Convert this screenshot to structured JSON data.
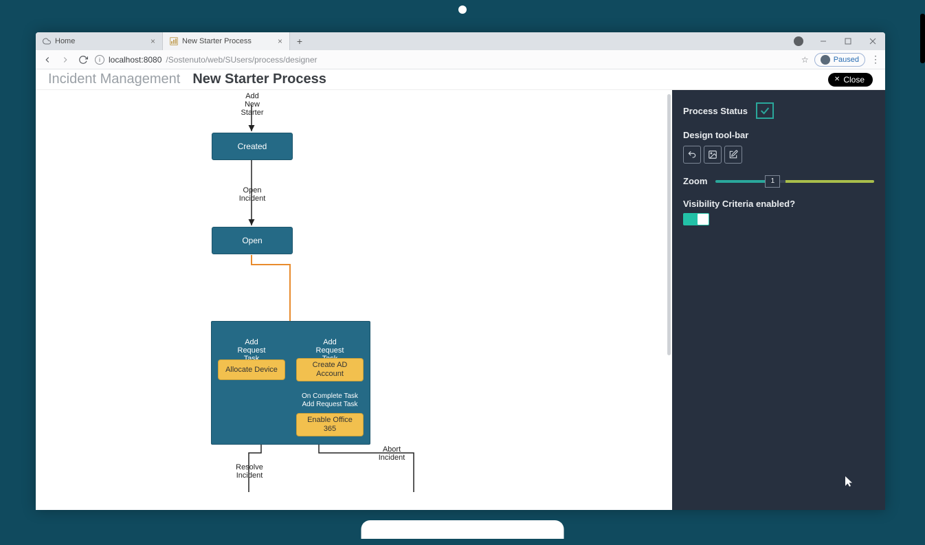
{
  "browser": {
    "tabs": [
      {
        "label": "Home"
      },
      {
        "label": "New Starter Process"
      }
    ],
    "url_host": "localhost:8080",
    "url_path": "/Sostenuto/web/SUsers/process/designer",
    "paused_label": "Paused"
  },
  "page": {
    "breadcrumb": "Incident Management",
    "title": "New Starter Process",
    "close_label": "Close"
  },
  "flow": {
    "labels": {
      "add_new_starter": "Add\nNew Starter",
      "open_incident": "Open\nIncident",
      "add_request_task_left": "Add\nRequest Task",
      "add_request_task_right": "Add\nRequest Task",
      "on_complete": "On Complete Task\nAdd Request Task",
      "abort_incident": "Abort\nIncident",
      "resolve_incident": "Resolve\nIncident"
    },
    "nodes": {
      "created": "Created",
      "open": "Open",
      "allocate_device": "Allocate Device",
      "create_ad_account": "Create AD\nAccount",
      "enable_office": "Enable Office\n365"
    }
  },
  "panel": {
    "process_status_label": "Process Status",
    "design_toolbar_label": "Design tool-bar",
    "zoom_label": "Zoom",
    "zoom_value": "1",
    "visibility_label": "Visibility Criteria enabled?"
  }
}
